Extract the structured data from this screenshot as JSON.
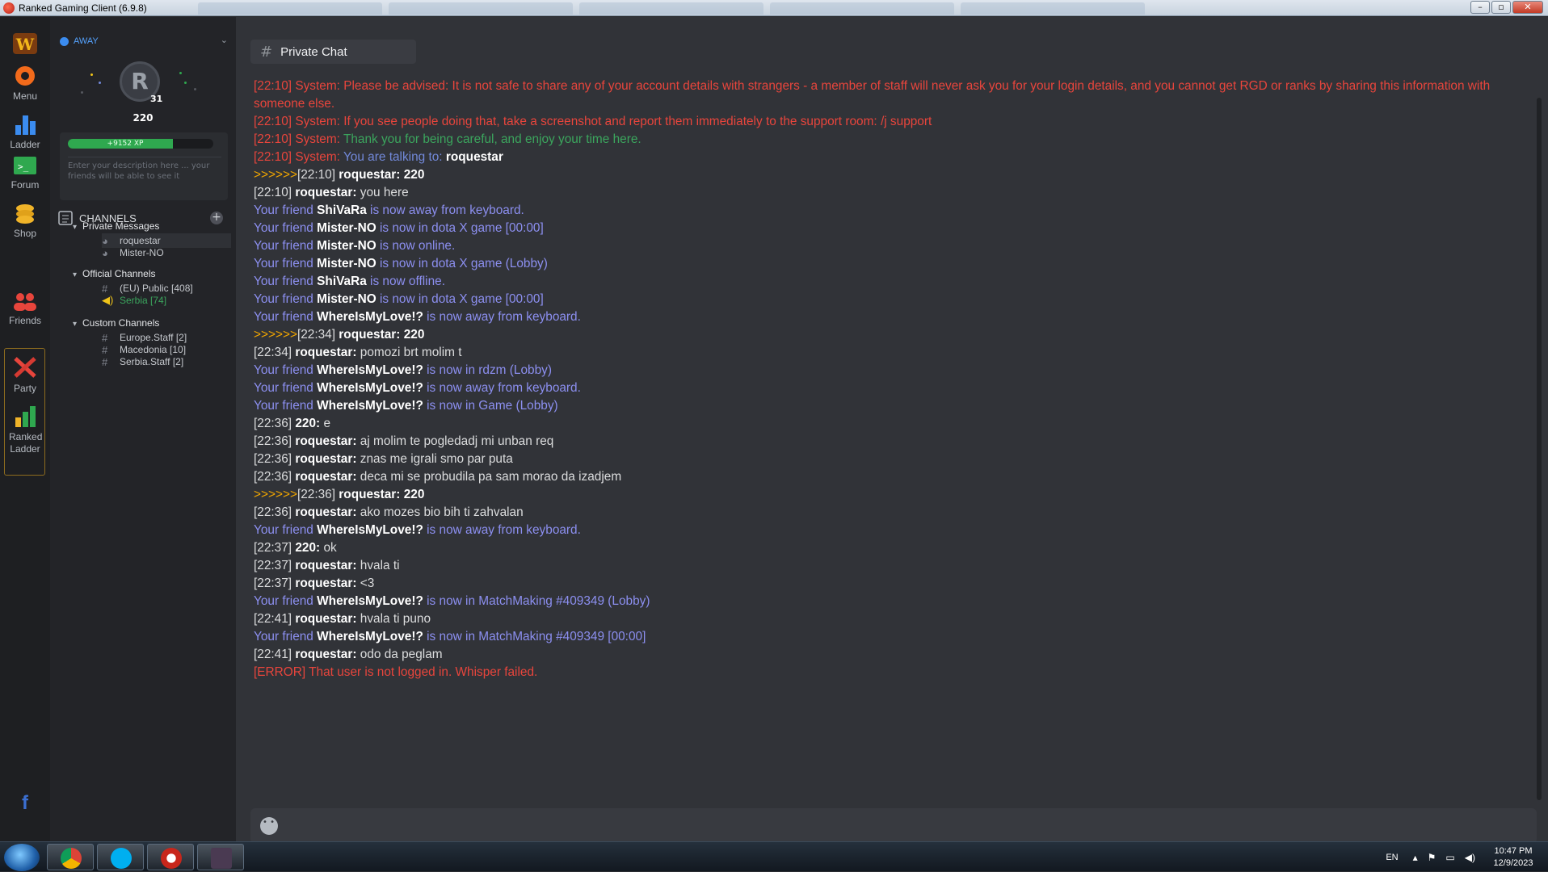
{
  "window": {
    "title": "Ranked Gaming Client (6.9.8)"
  },
  "rail": [
    {
      "label": "Menu"
    },
    {
      "label": "Ladder"
    },
    {
      "label": "Forum"
    },
    {
      "label": "Shop"
    },
    {
      "label": "Friends"
    },
    {
      "label": "Party"
    },
    {
      "label": "Ranked Ladder"
    }
  ],
  "profile": {
    "status": "AWAY",
    "level": "31",
    "name": "220",
    "xp_label": "+9152 XP",
    "xp_fraction": 0.72,
    "description_placeholder": "Enter your description here ... your friends will be able to see it"
  },
  "channels": {
    "header": "CHANNELS",
    "groups": [
      {
        "name": "Private Messages",
        "items": [
          "roquestar",
          "Mister-NO"
        ]
      },
      {
        "name": "Official Channels",
        "items": [
          "(EU) Public [408]",
          "Serbia [74]"
        ]
      },
      {
        "name": "Custom Channels",
        "items": [
          "Europe.Staff [2]",
          "Macedonia [10]",
          "Serbia.Staff [2]"
        ]
      }
    ]
  },
  "chat": {
    "tab_title": "Private Chat",
    "messages": [
      {
        "type": "system",
        "ts": "[22:10] System:",
        "text": "Please be advised: It is not safe to share any of your account details with strangers - a member of staff will never ask you for your login details, and you cannot get RGD or ranks by sharing this information with someone else.",
        "color": "red"
      },
      {
        "type": "system",
        "ts": "[22:10] System:",
        "text": "If you see people doing that, take a screenshot and report them immediately to the support room: /j support",
        "color": "red"
      },
      {
        "type": "system",
        "ts": "[22:10] System:",
        "text": "Thank you for being careful, and enjoy your time here.",
        "color": "green"
      },
      {
        "type": "system-talk",
        "ts": "[22:10] System:",
        "text": "You are talking to:",
        "name": "roquestar"
      },
      {
        "type": "whisper-out",
        "arrow": ">>>>>>",
        "ts": "[22:10]",
        "name": "roquestar:",
        "text": "220"
      },
      {
        "type": "chat",
        "ts": "[22:10]",
        "name": "roquestar:",
        "text": "you here"
      },
      {
        "type": "friend",
        "pre": "Your friend",
        "name": "ShiVaRa",
        "text": "is now away from keyboard."
      },
      {
        "type": "friend",
        "pre": "Your friend",
        "name": "Mister-NO",
        "text": "is now in dota X game [00:00]"
      },
      {
        "type": "friend",
        "pre": "Your friend",
        "name": "Mister-NO",
        "text": "is now online."
      },
      {
        "type": "friend",
        "pre": "Your friend",
        "name": "Mister-NO",
        "text": "is now in dota X game (Lobby)"
      },
      {
        "type": "friend",
        "pre": "Your friend",
        "name": "ShiVaRa",
        "text": "is now offline."
      },
      {
        "type": "friend",
        "pre": "Your friend",
        "name": "Mister-NO",
        "text": "is now in dota X game [00:00]"
      },
      {
        "type": "friend",
        "pre": "Your friend",
        "name": "WhereIsMyLove!?",
        "text": "is now away from keyboard."
      },
      {
        "type": "whisper-out",
        "arrow": ">>>>>>",
        "ts": "[22:34]",
        "name": "roquestar:",
        "text": "220"
      },
      {
        "type": "chat",
        "ts": "[22:34]",
        "name": "roquestar:",
        "text": "pomozi brt molim t"
      },
      {
        "type": "friend",
        "pre": "Your friend",
        "name": "WhereIsMyLove!?",
        "text": "is now in rdzm (Lobby)"
      },
      {
        "type": "friend",
        "pre": "Your friend",
        "name": "WhereIsMyLove!?",
        "text": "is now away from keyboard."
      },
      {
        "type": "friend",
        "pre": "Your friend",
        "name": "WhereIsMyLove!?",
        "text": "is now in Game (Lobby)"
      },
      {
        "type": "chat",
        "ts": "[22:36]",
        "name": "220:",
        "text": "e"
      },
      {
        "type": "chat",
        "ts": "[22:36]",
        "name": "roquestar:",
        "text": "aj molim te pogledadj mi unban req"
      },
      {
        "type": "chat",
        "ts": "[22:36]",
        "name": "roquestar:",
        "text": "znas me igrali smo par puta"
      },
      {
        "type": "chat",
        "ts": "[22:36]",
        "name": "roquestar:",
        "text": "deca mi se probudila pa sam morao da izadjem"
      },
      {
        "type": "whisper-out",
        "arrow": ">>>>>>",
        "ts": "[22:36]",
        "name": "roquestar:",
        "text": "220"
      },
      {
        "type": "chat",
        "ts": "[22:36]",
        "name": "roquestar:",
        "text": "ako mozes bio bih ti zahvalan"
      },
      {
        "type": "friend",
        "pre": "Your friend",
        "name": "WhereIsMyLove!?",
        "text": "is now away from keyboard."
      },
      {
        "type": "chat",
        "ts": "[22:37]",
        "name": "220:",
        "text": "ok"
      },
      {
        "type": "chat",
        "ts": "[22:37]",
        "name": "roquestar:",
        "text": "hvala ti"
      },
      {
        "type": "chat",
        "ts": "[22:37]",
        "name": "roquestar:",
        "text": "<3"
      },
      {
        "type": "friend",
        "pre": "Your friend",
        "name": "WhereIsMyLove!?",
        "text": "is now in MatchMaking #409349 (Lobby)"
      },
      {
        "type": "chat",
        "ts": "[22:41]",
        "name": "roquestar:",
        "text": "hvala ti puno"
      },
      {
        "type": "friend",
        "pre": "Your friend",
        "name": "WhereIsMyLove!?",
        "text": "is now in MatchMaking #409349 [00:00]"
      },
      {
        "type": "chat",
        "ts": "[22:41]",
        "name": "roquestar:",
        "text": "odo da peglam"
      },
      {
        "type": "error",
        "text": "[ERROR] That user is not logged in. Whisper failed."
      }
    ]
  },
  "taskbar": {
    "language": "EN",
    "time": "10:47 PM",
    "date": "12/9/2023"
  },
  "colors": {
    "system_red": "#e8453c",
    "system_green": "#3ba55d",
    "system_blue": "#7289da",
    "friend_purple": "#8c8ff0",
    "whisper_arrow": "#f0a500",
    "status_away": "#3b8cf0"
  }
}
